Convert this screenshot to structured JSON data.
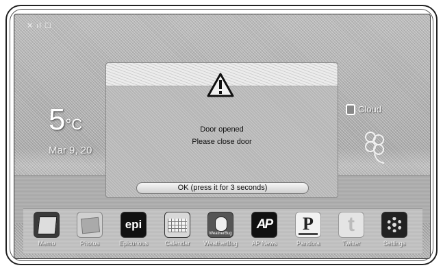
{
  "status_bar": {
    "text": "✕ ıl ☐"
  },
  "weather": {
    "temperature": "5",
    "unit": "°C",
    "date": "Mar 9, 20",
    "condition": "Cloud"
  },
  "dialog": {
    "icon": "warning-icon",
    "line1": "Door opened",
    "line2": "Please close door",
    "ok_label": "OK (press it for 3 seconds)"
  },
  "dock": {
    "apps": [
      {
        "label": "Memo",
        "icon": "memo-icon"
      },
      {
        "label": "Photos",
        "icon": "photos-icon"
      },
      {
        "label": "Epicurious",
        "icon_text": "epi"
      },
      {
        "label": "Calendar",
        "icon": "calendar-icon"
      },
      {
        "label": "WeatherBug",
        "icon_text": "WeatherBug"
      },
      {
        "label": "AP News",
        "icon_text": "AP"
      },
      {
        "label": "Pandora",
        "icon_text": "P"
      },
      {
        "label": "Twitter",
        "icon_text": "t"
      },
      {
        "label": "Settings",
        "icon": "gear-icon"
      }
    ]
  }
}
